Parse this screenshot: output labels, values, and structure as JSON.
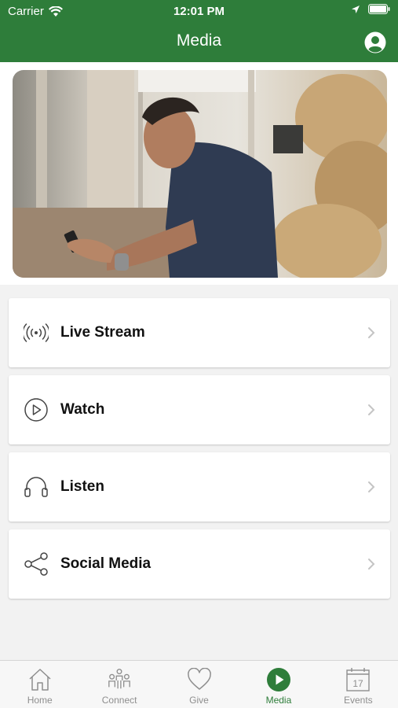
{
  "status_bar": {
    "carrier": "Carrier",
    "time": "12:01 PM"
  },
  "nav": {
    "title": "Media"
  },
  "hero": {
    "icon": "photo-man-with-phone"
  },
  "menu": [
    {
      "label": "Live Stream",
      "icon": "broadcast-icon"
    },
    {
      "label": "Watch",
      "icon": "play-circle-icon"
    },
    {
      "label": "Listen",
      "icon": "headphones-icon"
    },
    {
      "label": "Social Media",
      "icon": "share-icon"
    }
  ],
  "tabs": [
    {
      "label": "Home",
      "icon": "home-icon",
      "active": false
    },
    {
      "label": "Connect",
      "icon": "people-icon",
      "active": false
    },
    {
      "label": "Give",
      "icon": "heart-icon",
      "active": false
    },
    {
      "label": "Media",
      "icon": "play-icon",
      "active": true
    },
    {
      "label": "Events",
      "icon": "calendar-icon",
      "active": false
    }
  ],
  "colors": {
    "brand": "#2e7d3a",
    "inactive": "#8e8e8e"
  }
}
